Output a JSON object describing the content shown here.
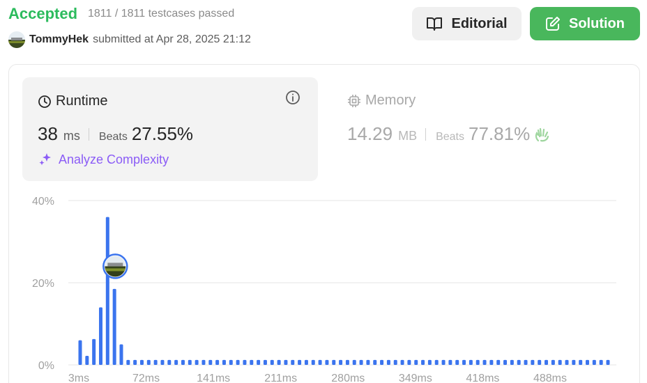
{
  "header": {
    "status": "Accepted",
    "testcases": "1811 / 1811 testcases passed",
    "username": "TommyHek",
    "submitted_text": "submitted at Apr 28, 2025 21:12"
  },
  "buttons": {
    "editorial": "Editorial",
    "solution": "Solution"
  },
  "runtime": {
    "title": "Runtime",
    "value": "38",
    "unit": "ms",
    "beats_label": "Beats",
    "beats_value": "27.55%",
    "analyze_label": "Analyze Complexity"
  },
  "memory": {
    "title": "Memory",
    "value": "14.29",
    "unit": "MB",
    "beats_label": "Beats",
    "beats_value": "77.81%"
  },
  "colors": {
    "accepted": "#2cbb5d",
    "solution_button": "#49b75c",
    "bar": "#3b74ee",
    "analyze": "#8b5cf6"
  },
  "chart_data": {
    "type": "bar",
    "y_ticks": [
      "40%",
      "20%",
      "0%"
    ],
    "ylim": [
      0,
      40
    ],
    "x_ticks": [
      "3ms",
      "72ms",
      "141ms",
      "211ms",
      "280ms",
      "349ms",
      "418ms",
      "488ms"
    ],
    "values": [
      6,
      2.2,
      6.3,
      14,
      36,
      18.5,
      5,
      1.2,
      1.2,
      1.2,
      1.2,
      1.2,
      1.2,
      1.2,
      1.2,
      1.2,
      1.2,
      1.2,
      1.2,
      1.2,
      1.2,
      1.2,
      1.2,
      1.2,
      1.2,
      1.2,
      1.2,
      1.2,
      1.2,
      1.2,
      1.2,
      1.2,
      1.2,
      1.2,
      1.2,
      1.2,
      1.2,
      1.2,
      1.2,
      1.2,
      1.2,
      1.2,
      1.2,
      1.2,
      1.2,
      1.2,
      1.2,
      1.2,
      1.2,
      1.2,
      1.2,
      1.2,
      1.2,
      1.2,
      1.2,
      1.2,
      1.2,
      1.2,
      1.2,
      1.2,
      1.2,
      1.2,
      1.2,
      1.2,
      1.2,
      1.2,
      1.2,
      1.2,
      1.2,
      1.2,
      1.2,
      1.2,
      1.2,
      1.2,
      1.2,
      1.2,
      1.2,
      1.2
    ],
    "highlight_index": 4,
    "highlight_value_y": 24
  }
}
